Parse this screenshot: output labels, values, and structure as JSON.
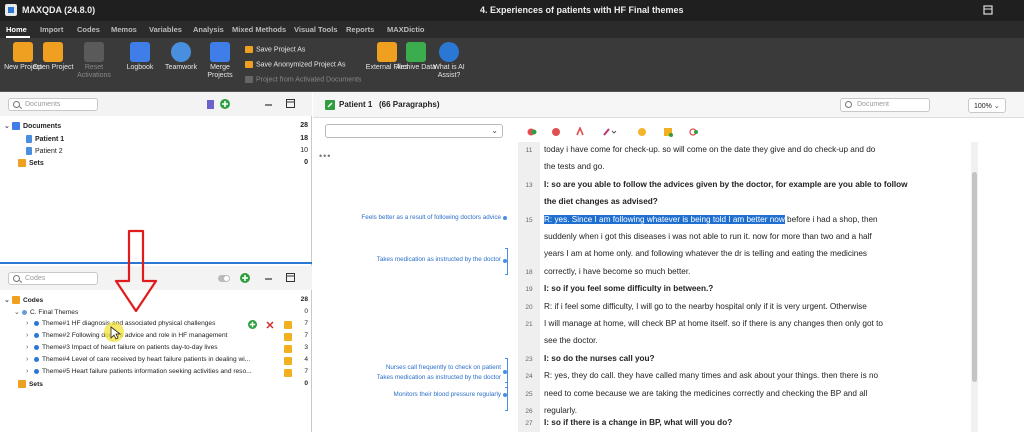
{
  "app": {
    "name": "MAXQDA (24.8.0)",
    "document_title": "4. Experiences of patients with HF Final themes"
  },
  "menu": {
    "items": [
      "Home",
      "Import",
      "Codes",
      "Memos",
      "Variables",
      "Analysis",
      "Mixed Methods",
      "Visual Tools",
      "Reports",
      "MAXDictio"
    ],
    "active": "Home"
  },
  "ribbon": {
    "new_project": "New Project",
    "open_project": "Open Project",
    "reset_activations": "Reset Activations",
    "logbook": "Logbook",
    "teamwork": "Teamwork",
    "merge_projects": "Merge Projects",
    "save_project_as": "Save Project As",
    "save_anonymized": "Save Anonymized Project As",
    "project_from_activated": "Project from Activated Documents",
    "external_files": "External Files",
    "archive_data": "Archive Data",
    "what_is_ai": "What is AI Assist?"
  },
  "documents_pane": {
    "search_placeholder": "Documents",
    "root": {
      "label": "Documents",
      "count": "28"
    },
    "items": [
      {
        "label": "Patient 1",
        "count": "18"
      },
      {
        "label": "Patient 2",
        "count": "10"
      }
    ],
    "sets": {
      "label": "Sets",
      "count": "0"
    }
  },
  "codes_pane": {
    "search_placeholder": "Codes",
    "root": {
      "label": "Codes",
      "count": "28"
    },
    "group": {
      "label": "C. Final Themes",
      "count": "0"
    },
    "items": [
      {
        "label": "Theme#1 HF diagnosis and associated physical challenges",
        "count": "7"
      },
      {
        "label": "Theme#2 Following doctors advice and role in HF management",
        "count": "7"
      },
      {
        "label": "Theme#3 Impact of heart failure on patients day-to-day lives",
        "count": "3"
      },
      {
        "label": "Theme#4 Level of care received  by heart failure patients in  dealing wi...",
        "count": "4"
      },
      {
        "label": "Theme#5 Heart failure patients information seeking activities and reso...",
        "count": "7"
      }
    ],
    "sets": {
      "label": "Sets",
      "count": "0"
    }
  },
  "document_browser": {
    "title": "Patient 1",
    "subtitle": "(66 Paragraphs)",
    "search_placeholder": "Document",
    "zoom": "100%",
    "coding_labels": [
      "Feels better as a result of following doctors advice",
      "Takes medication as instructed by the doctor",
      "Nurses call frequently to check on patient",
      "Takes medication as instructed by the doctor",
      "Monitors their blood pressure regularly"
    ],
    "lines": [
      {
        "num": "11",
        "text": "today i have come for check-up. so will come on the date they give and do check-up and do"
      },
      {
        "num": "",
        "text": "the tests and go."
      },
      {
        "num": "13",
        "text": "I: so are you able to follow the advices given by the doctor, for example are you able to follow"
      },
      {
        "num": "",
        "text": "the diet changes as advised?"
      },
      {
        "num": "15",
        "text_hl": "R: yes. Since I am following whatever is being told I am better now",
        "text_rest": " before i had a shop, then"
      },
      {
        "num": "",
        "text": "suddenly when i got this diseases i was not able to run it. now for more than two and a half"
      },
      {
        "num": "",
        "text": "years I am at home only. and following whatever the dr is telling and eating the medicines"
      },
      {
        "num": "18",
        "text": "correctly, i have become so much better."
      },
      {
        "num": "19",
        "text": "I: so if you feel some difficulty in between.?"
      },
      {
        "num": "20",
        "text": "R: if i feel some difficulty, I will go to the nearby hospital only if it is very urgent. Otherwise"
      },
      {
        "num": "21",
        "text": "I will manage at home, will check BP at home itself. so if there is any changes then only got to"
      },
      {
        "num": "",
        "text": "see the doctor."
      },
      {
        "num": "23",
        "text": "I: so do the nurses call you?"
      },
      {
        "num": "24",
        "text": "R: yes, they do call. they have called many times and ask about your things. then there is no"
      },
      {
        "num": "25",
        "text": "need to come because we are taking the medicines correctly and checking the BP and all"
      },
      {
        "num": "26",
        "text": "regularly."
      },
      {
        "num": "27",
        "text": "I: so if there is a change in BP, what will you do?"
      }
    ]
  }
}
